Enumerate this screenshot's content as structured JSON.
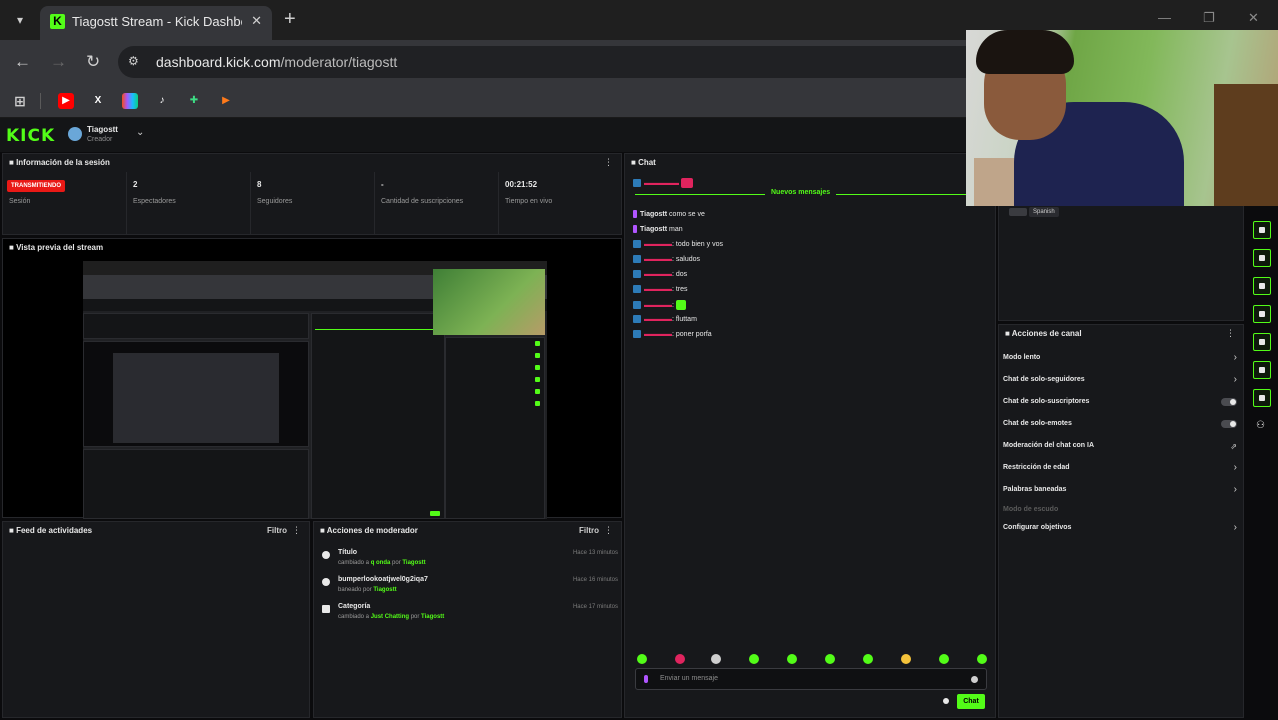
{
  "browser": {
    "tab_title": "Tiagostt Stream - Kick Dashboard",
    "tab_close": "✕",
    "new_tab": "+",
    "url_domain": "dashboard.kick.com",
    "url_path": "/moderator/tiagostt",
    "back": "←",
    "forward": "→",
    "reload": "↻",
    "win_minimize": "—",
    "win_restore": "❐",
    "win_close": "✕",
    "bookmarks": [
      "apps-icon",
      "youtube-icon",
      "x-icon",
      "figma-icon",
      "tiktok-icon",
      "gamepad-icon",
      "play-icon"
    ]
  },
  "kick": {
    "logo": "KICK",
    "user": "Tiagostt",
    "role": "Creador",
    "accent": "#53fc18"
  },
  "session": {
    "title": "Información de la sesión",
    "live_badge": "TRANSMITIENDO",
    "live_label": "Sesión",
    "viewers_value": "2",
    "viewers_label": "Espectadores",
    "followers_value": "8",
    "followers_label": "Seguidores",
    "subs_value": "-",
    "subs_label": "Cantidad de suscripciones",
    "uptime_value": "00:21:52",
    "uptime_label": "Tiempo en vivo"
  },
  "preview": {
    "title": "Vista previa del stream"
  },
  "activity": {
    "title": "Feed de actividades",
    "filter": "Filtro"
  },
  "modlog": {
    "title": "Acciones de moderador",
    "filter": "Filtro",
    "items": [
      {
        "title": "Título",
        "pre": "cambiado a ",
        "value": "q onda",
        "by": " por ",
        "user": "Tiagostt",
        "time": "Hace 13 minutos"
      },
      {
        "title": "bumperlookoatjwel0g2iqa7",
        "pre": "baneado por ",
        "value": "",
        "by": "",
        "user": "Tiagostt",
        "time": "Hace 16 minutos"
      },
      {
        "title": "Categoría",
        "pre": "cambiado a ",
        "value": "Just Chatting",
        "by": " por ",
        "user": "Tiagostt",
        "time": "Hace 17 minutos"
      }
    ]
  },
  "chat": {
    "title": "Chat",
    "new_messages": "Nuevos mensajes",
    "messages": [
      {
        "user": "",
        "text": "",
        "badge": "blue"
      },
      {
        "user": "Tiagostt",
        "text": " como se ve",
        "badge": "purple",
        "own": true
      },
      {
        "user": "Tiagostt",
        "text": " man",
        "badge": "purple",
        "own": true
      },
      {
        "user": "",
        "text": ": todo bien y vos",
        "badge": "blue"
      },
      {
        "user": "",
        "text": ": saludos",
        "badge": "blue"
      },
      {
        "user": "",
        "text": ": dos",
        "badge": "blue"
      },
      {
        "user": "",
        "text": ": tres",
        "badge": "blue"
      },
      {
        "user": "",
        "text": ":",
        "badge": "blue"
      },
      {
        "user": "",
        "text": ": fluttam",
        "badge": "blue"
      },
      {
        "user": "",
        "text": ": poner porfa",
        "badge": "blue"
      }
    ],
    "input_placeholder": "Enviar un mensaje",
    "send_label": "Chat"
  },
  "channel_actions": {
    "title": "Acciones de canal",
    "items": [
      {
        "label": "Modo lento",
        "control": "chevron"
      },
      {
        "label": "Chat de solo-seguidores",
        "control": "chevron"
      },
      {
        "label": "Chat de solo-suscriptores",
        "control": "toggle"
      },
      {
        "label": "Chat de solo-emotes",
        "control": "toggle"
      },
      {
        "label": "Moderación del chat con IA",
        "control": "link"
      },
      {
        "label": "Restricción de edad",
        "control": "chevron"
      },
      {
        "label": "Palabras baneadas",
        "control": "chevron"
      },
      {
        "label": "Modo de escudo",
        "control": "dim"
      },
      {
        "label": "Configurar objetivos",
        "control": "chevron"
      }
    ]
  },
  "user_card": {
    "badge_label": "Spanish"
  },
  "rail_icons": [
    "kick-icon",
    "chat-icon",
    "clipboard-icon",
    "message-icon",
    "link-icon",
    "calendar-icon",
    "tool-icon",
    "people-icon"
  ]
}
